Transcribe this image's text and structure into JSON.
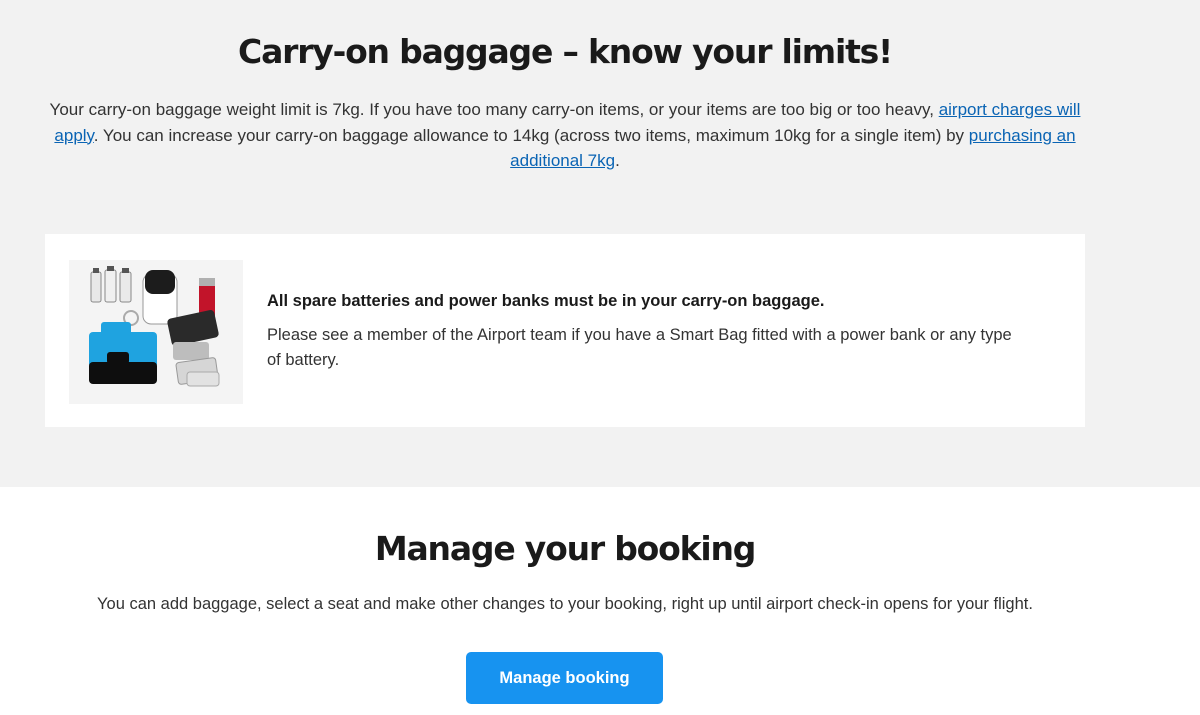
{
  "carry_on": {
    "title": "Carry-on baggage – know your limits!",
    "intro_part1": "Your carry-on baggage weight limit is 7kg. If you have too many carry-on items, or your items are too big or too heavy, ",
    "link_charges": "airport charges will apply",
    "intro_part2": ". You can increase your carry-on baggage allowance to 14kg (across two items, maximum 10kg for a single item) by ",
    "link_purchase": "purchasing an additional 7kg",
    "intro_part3": "."
  },
  "battery_notice": {
    "heading": "All spare batteries and power banks must be in your carry-on baggage.",
    "body": "Please see a member of the Airport team if you have a Smart Bag fitted with a power bank or any type of battery."
  },
  "manage": {
    "title": "Manage your booking",
    "text": "You can add baggage, select a seat and make other changes to your booking, right up until airport check-in opens for your flight.",
    "button_label": "Manage booking"
  },
  "colors": {
    "link": "#0a64b4",
    "button": "#1793f0",
    "section_bg": "#f2f2f2"
  }
}
